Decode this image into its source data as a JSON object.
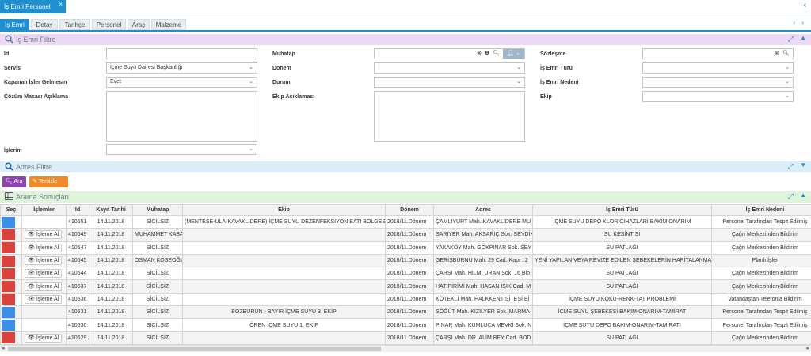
{
  "window": {
    "tab_title": "İş Emri Personel",
    "close": "×",
    "nav_arrows": "‹"
  },
  "subtabs": [
    "İş Emri",
    "Detay",
    "Tarihçe",
    "Personel",
    "Araç",
    "Malzeme"
  ],
  "subtab_nav": "‹ ›",
  "filter_section": {
    "title": "İş Emri Filtre",
    "col1": {
      "id_label": "Id",
      "id_value": "",
      "servis_label": "Servis",
      "servis_value": "İçme Suyu Dairesi Başkanlığı",
      "kapanan_label": "Kapanan İşler Gelmesin",
      "kapanan_value": "Evet",
      "cozum_label": "Çözüm Masası Açıklama",
      "cozum_value": "",
      "islerim_label": "İşlerim",
      "islerim_value": ""
    },
    "col2": {
      "muhatap_label": "Muhatap",
      "muhatap_value": "",
      "donem_label": "Dönem",
      "donem_value": "",
      "durum_label": "Durum",
      "durum_value": "",
      "ekip_aciklama_label": "Ekip Açıklaması",
      "ekip_aciklama_value": ""
    },
    "col3": {
      "sozlesme_label": "Sözleşme",
      "sozlesme_value": "",
      "isemri_turu_label": "İş Emri Türü",
      "isemri_turu_value": "",
      "isemri_nedeni_label": "İş Emri Nedeni",
      "isemri_nedeni_value": "",
      "ekip_label": "Ekip",
      "ekip_value": ""
    }
  },
  "address_section": {
    "title": "Adres Filtre"
  },
  "buttons": {
    "ara": "Ara",
    "temizle": "Temizle"
  },
  "results_section": {
    "title": "Arama Sonuçları"
  },
  "table": {
    "columns": [
      "Seç",
      "İşlemler",
      "Id",
      "Kayıt Tarihi",
      "Muhatap",
      "Ekip",
      "Dönem",
      "Adres",
      "İş Emri Türü",
      "İş Emri Nedeni"
    ],
    "rows": [
      {
        "sel": "blue",
        "action": "",
        "id": "410651",
        "date": "14.11.2018",
        "muhatap": "SİCİLSİZ",
        "ekip": "(MENTEŞE-ULA-KAVAKLIDERE) İÇME SUYU DEZENFEKSİYON BATI BÖLGESİ",
        "donem": "2018/11.Dönem",
        "adres": "ÇAMLIYURT Mah. KAVAKLIDERE MU",
        "tur": "İÇME SUYU DEPO KLOR CİHAZLARI BAKIM ONARIM",
        "neden": "Personel Tarafından Tespit Edilmiş"
      },
      {
        "sel": "red",
        "action": "İşleme Al",
        "id": "410649",
        "date": "14.11.2018",
        "muhatap": "MUHAMMET KABA",
        "ekip": "",
        "donem": "2018/11.Dönem",
        "adres": "SARIYER Mah. AKSARIÇ Sok. SEYDİK",
        "tur": "SU KESİNTİSİ",
        "neden": "Çağrı Merkezinden Bildirim"
      },
      {
        "sel": "red",
        "action": "İşleme Al",
        "id": "410647",
        "date": "14.11.2018",
        "muhatap": "SİCİLSİZ",
        "ekip": "",
        "donem": "2018/11.Dönem",
        "adres": "YAKAKÖY Mah. GÖKPINAR Sok. SEY",
        "tur": "SU PATLAĞI",
        "neden": "Çağrı Merkezinden Bildirim"
      },
      {
        "sel": "red",
        "action": "İşleme Al",
        "id": "410645",
        "date": "14.11.2018",
        "muhatap": "OSMAN KÖSEOĞLU",
        "ekip": "",
        "donem": "2018/11.Dönem",
        "adres": "GERİŞBURNU Mah. 29 Cad. Kapı : 2",
        "tur": "YENİ YAPILAN VEYA REVİZE EDİLEN ŞEBEKELERİN HARİTALANMASI",
        "neden": "Planlı İşler"
      },
      {
        "sel": "red",
        "action": "İşleme Al",
        "id": "410644",
        "date": "14.11.2018",
        "muhatap": "SİCİLSİZ",
        "ekip": "",
        "donem": "2018/11.Dönem",
        "adres": "ÇARŞI Mah. HİLMİ URAN Sok. 16 Blo",
        "tur": "SU PATLAĞI",
        "neden": "Çağrı Merkezinden Bildirim"
      },
      {
        "sel": "red",
        "action": "İşleme Al",
        "id": "410637",
        "date": "14.11.2018",
        "muhatap": "SİCİLSİZ",
        "ekip": "",
        "donem": "2018/11.Dönem",
        "adres": "HATİPİRİMİ Mah. HASAN IŞIK Cad. M",
        "tur": "SU PATLAĞI",
        "neden": "Çağrı Merkezinden Bildirim"
      },
      {
        "sel": "red",
        "action": "İşleme Al",
        "id": "410636",
        "date": "14.11.2018",
        "muhatap": "SİCİLSİZ",
        "ekip": "",
        "donem": "2018/11.Dönem",
        "adres": "KÖTEKLİ Mah. HALKKENT SİTESİ Bİ",
        "tur": "İÇME SUYU KOKU-RENK-TAT PROBLEMİ",
        "neden": "Vatandaştan Telefonla Bildirim"
      },
      {
        "sel": "blue",
        "action": "",
        "id": "410631",
        "date": "14.11.2018",
        "muhatap": "SİCİLSİZ",
        "ekip": "BOZBURUN - BAYIR İÇME SUYU 3. EKİP",
        "donem": "2018/11.Dönem",
        "adres": "SÖĞÜT Mah. KIZILYER Sok. MARMA",
        "tur": "İÇME SUYU ŞEBEKESİ BAKIM-ONARIM-TAMİRAT",
        "neden": "Personel Tarafından Tespit Edilmiş"
      },
      {
        "sel": "blue",
        "action": "",
        "id": "410630",
        "date": "14.11.2018",
        "muhatap": "SİCİLSİZ",
        "ekip": "ÖREN İÇME SUYU 1. EKİP",
        "donem": "2018/11.Dönem",
        "adres": "PINAR Mah. KUMLUCA MEVKİ Sok. N",
        "tur": "İÇME SUYU DEPO BAKIM-ONARIM-TAMİRATI",
        "neden": "Personel Tarafından Tespit Edilmiş"
      },
      {
        "sel": "red",
        "action": "İşleme Al",
        "id": "410629",
        "date": "14.11.2018",
        "muhatap": "SİCİLSİZ",
        "ekip": "",
        "donem": "2018/11.Dönem",
        "adres": "ÇARŞI Mah. DR. ALİM BEY Cad. BOD",
        "tur": "SU PATLAĞI",
        "neden": "Çağrı Merkezinden Bildirim"
      }
    ]
  },
  "colors": {
    "primary": "#1f8fd0",
    "red": "#d9433b",
    "blue": "#3d8ee6",
    "purple": "#8e44ad",
    "orange": "#f08a24"
  }
}
